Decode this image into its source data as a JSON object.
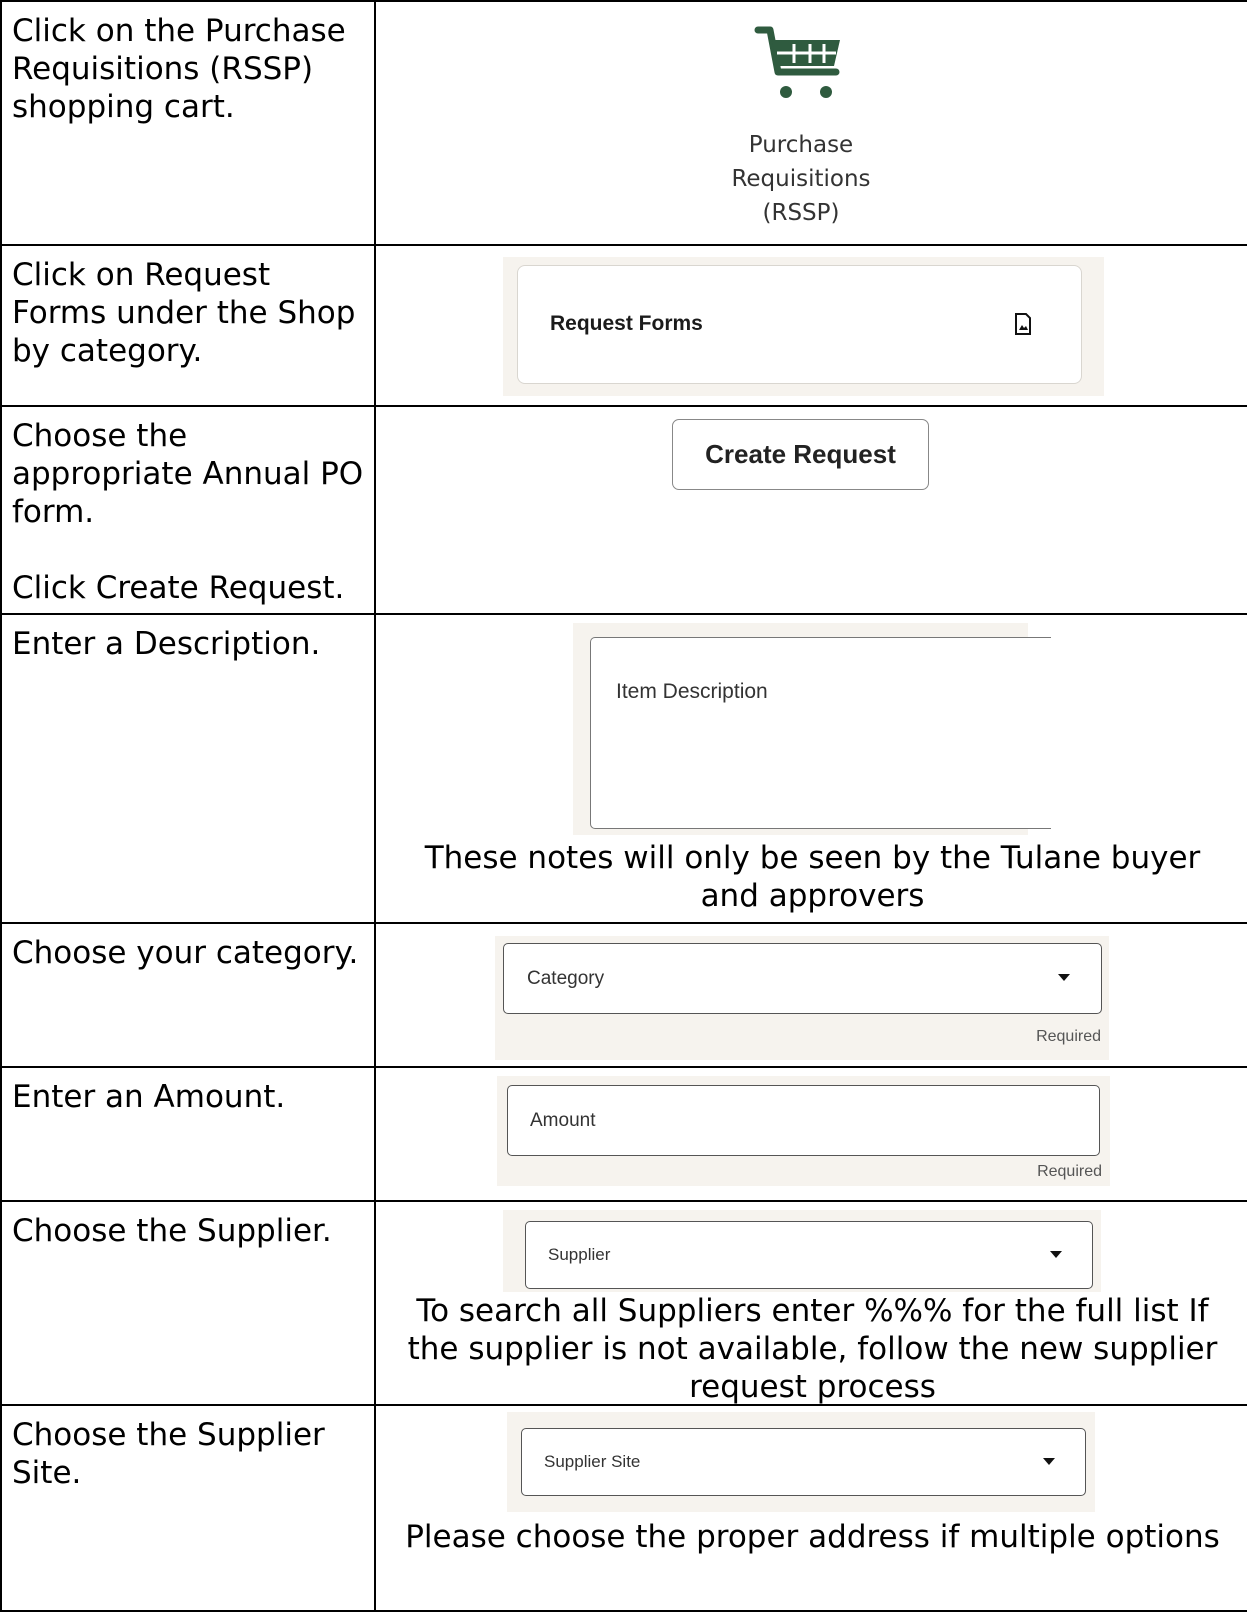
{
  "rows": [
    {
      "instruction": [
        "Click on the Purchase Requisitions (RSSP) shopping cart."
      ],
      "visual": {
        "icon": "shopping-cart-icon",
        "label_lines": [
          "Purchase",
          "Requisitions",
          "(RSSP)"
        ],
        "icon_color": "#2f5b3f"
      }
    },
    {
      "instruction": [
        "Click on Request Forms under the Shop by category."
      ],
      "visual": {
        "card_title": "Request Forms",
        "icon": "document-image-icon"
      }
    },
    {
      "instruction": [
        "Choose the appropriate Annual PO form.",
        "Click Create Request."
      ],
      "visual": {
        "button_label": "Create Request"
      }
    },
    {
      "instruction": [
        "Enter a Description."
      ],
      "visual": {
        "field_label": "Item Description",
        "note": "These notes will only be seen by the Tulane buyer and approvers"
      }
    },
    {
      "instruction": [
        "Choose your category."
      ],
      "visual": {
        "field_label": "Category",
        "helper": "Required",
        "icon": "caret-down-icon"
      }
    },
    {
      "instruction": [
        "Enter an Amount."
      ],
      "visual": {
        "field_label": "Amount",
        "helper": "Required"
      }
    },
    {
      "instruction": [
        "Choose the Supplier."
      ],
      "visual": {
        "field_label": "Supplier",
        "icon": "caret-down-icon",
        "note": "To search all Suppliers enter %%% for the full list If the supplier is not available, follow the new supplier request process"
      }
    },
    {
      "instruction": [
        "Choose the Supplier Site."
      ],
      "visual": {
        "field_label": "Supplier Site",
        "icon": "caret-down-icon",
        "note": "Please choose the proper address if multiple options"
      }
    }
  ],
  "colors": {
    "brand_green": "#2f5b3f",
    "panel_bg": "#f6f3ee"
  }
}
